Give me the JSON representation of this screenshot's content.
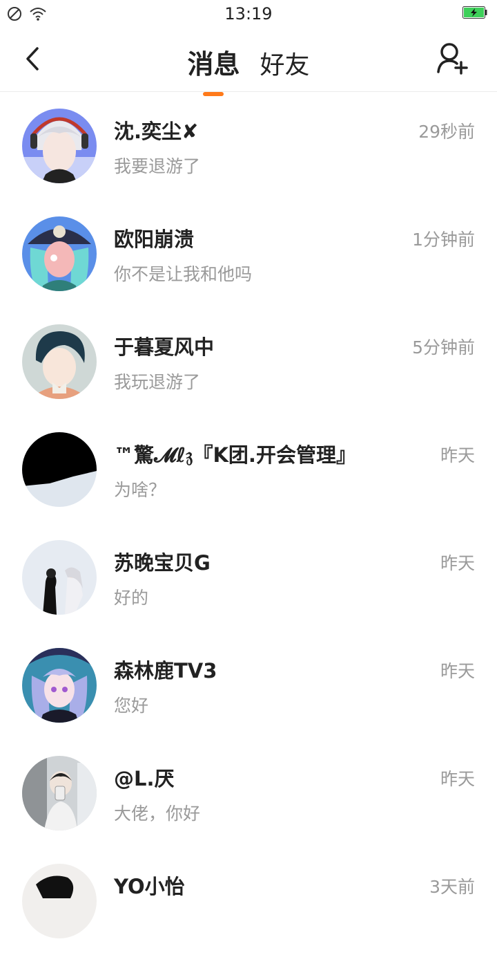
{
  "status_bar": {
    "time": "13:19",
    "icons": [
      "no-sim-icon",
      "wifi-icon",
      "battery-charging-icon"
    ]
  },
  "header": {
    "tabs": [
      {
        "label": "消息",
        "active": true
      },
      {
        "label": "好友",
        "active": false
      }
    ],
    "back_icon": "back-arrow-icon",
    "add_icon": "add-friend-icon",
    "accent_color": "#ff7a1a"
  },
  "conversations": [
    {
      "name": "沈.奕尘✘",
      "message": "我要退游了",
      "time": "29秒前"
    },
    {
      "name": "欧阳崩溃",
      "message": "你不是让我和他吗",
      "time": "1分钟前"
    },
    {
      "name": "于暮夏风中",
      "message": "我玩退游了",
      "time": "5分钟前"
    },
    {
      "name": "™驚𝓜ℓ𝔷『K团.开会管理』",
      "message": "为啥？",
      "time": "昨天"
    },
    {
      "name": "苏晚宝贝G",
      "message": "好的",
      "time": "昨天"
    },
    {
      "name": "森林鹿TV3",
      "message": "您好",
      "time": "昨天"
    },
    {
      "name": "@L.厌",
      "message": "大佬，你好",
      "time": "昨天"
    },
    {
      "name": "YO小怡",
      "message": "",
      "time": "3天前"
    }
  ]
}
